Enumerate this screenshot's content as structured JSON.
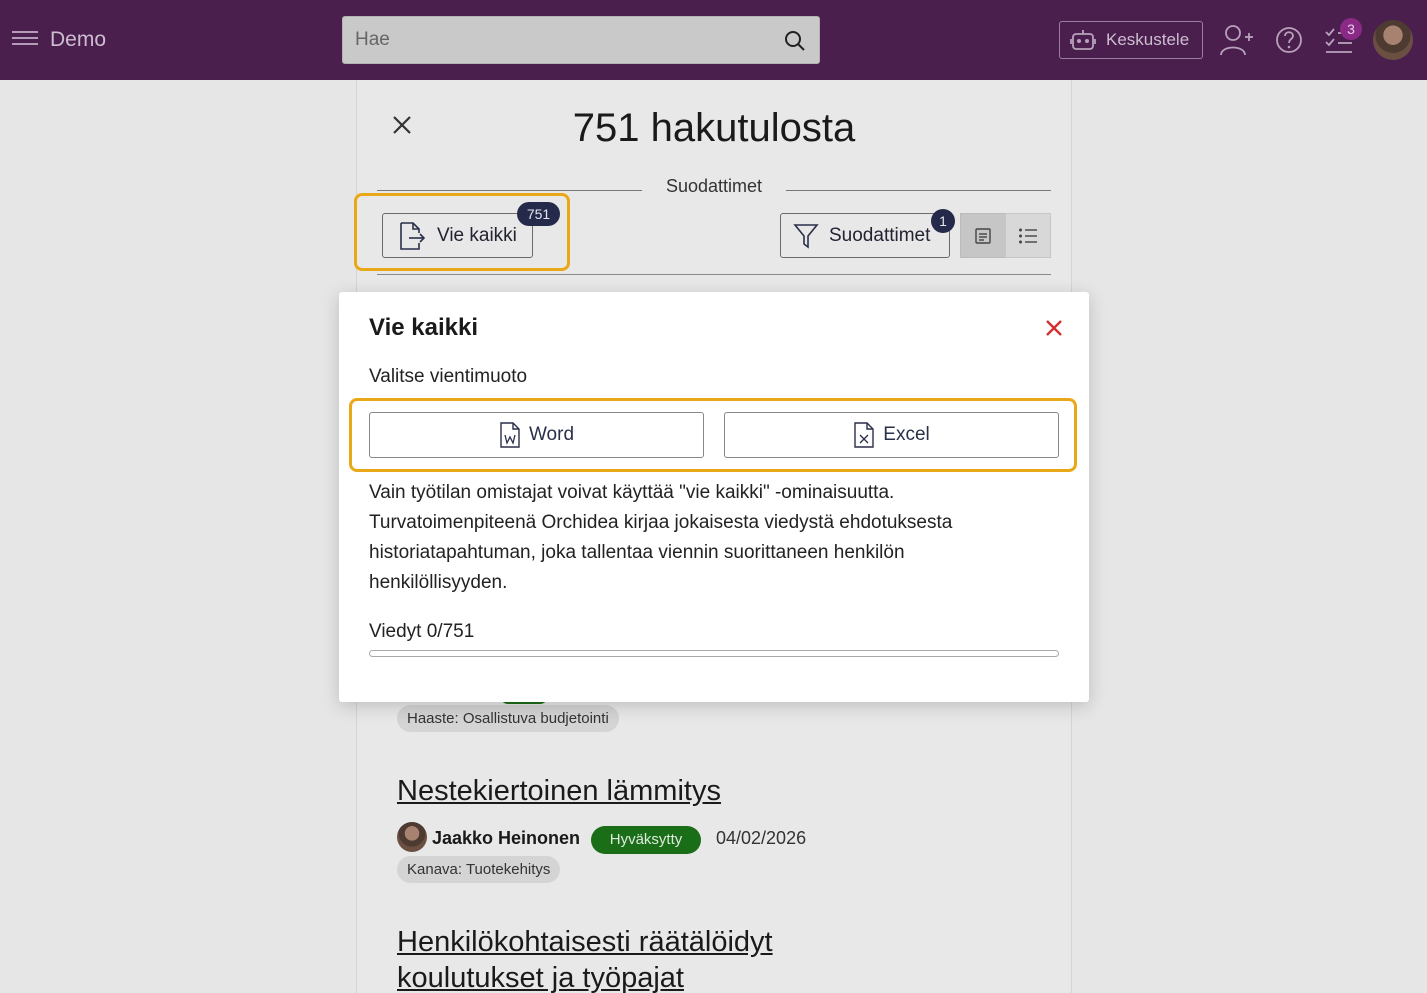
{
  "app": {
    "title": "Demo"
  },
  "search": {
    "placeholder": "Hae"
  },
  "header": {
    "chat_label": "Keskustele",
    "tasks_count": "3"
  },
  "results": {
    "title": "751 hakutulosta",
    "filters_heading": "Suodattimet"
  },
  "toolbar": {
    "export_all_label": "Vie kaikki",
    "export_count": "751",
    "filters_label": "Suodattimet",
    "filters_count": "1"
  },
  "modal": {
    "title": "Vie kaikki",
    "subtitle": "Valitse vientimuoto",
    "word_label": "Word",
    "excel_label": "Excel",
    "info": "Vain työtilan omistajat voivat käyttää \"vie kaikki\" -ominaisuutta. Turvatoimenpiteenä Orchidea kirjaa jokaisesta viedystä ehdotuksesta historiatapahtuman, joka tallentaa viennin suorittaneen henkilön henkilöllisyyden.",
    "progress_label": "Viedyt 0/751",
    "progress_fraction": 0
  },
  "ideas": [
    {
      "chip": "Haaste: Osallistuva budjetointi"
    },
    {
      "title": "Nestekiertoinen lämmitys",
      "author": "Jaakko Heinonen",
      "status": "Hyväksytty",
      "date": "04/02/2026",
      "chip": "Kanava: Tuotekehitys"
    },
    {
      "title": "Henkilökohtaisesti räätälöidyt koulutukset ja työpajat"
    }
  ],
  "colors": {
    "topbar": "#4a1f4e",
    "accent_highlight": "#e9a817",
    "badge": "#252a4a",
    "status_green": "#1a6e17",
    "close_red": "#d32f2f"
  }
}
